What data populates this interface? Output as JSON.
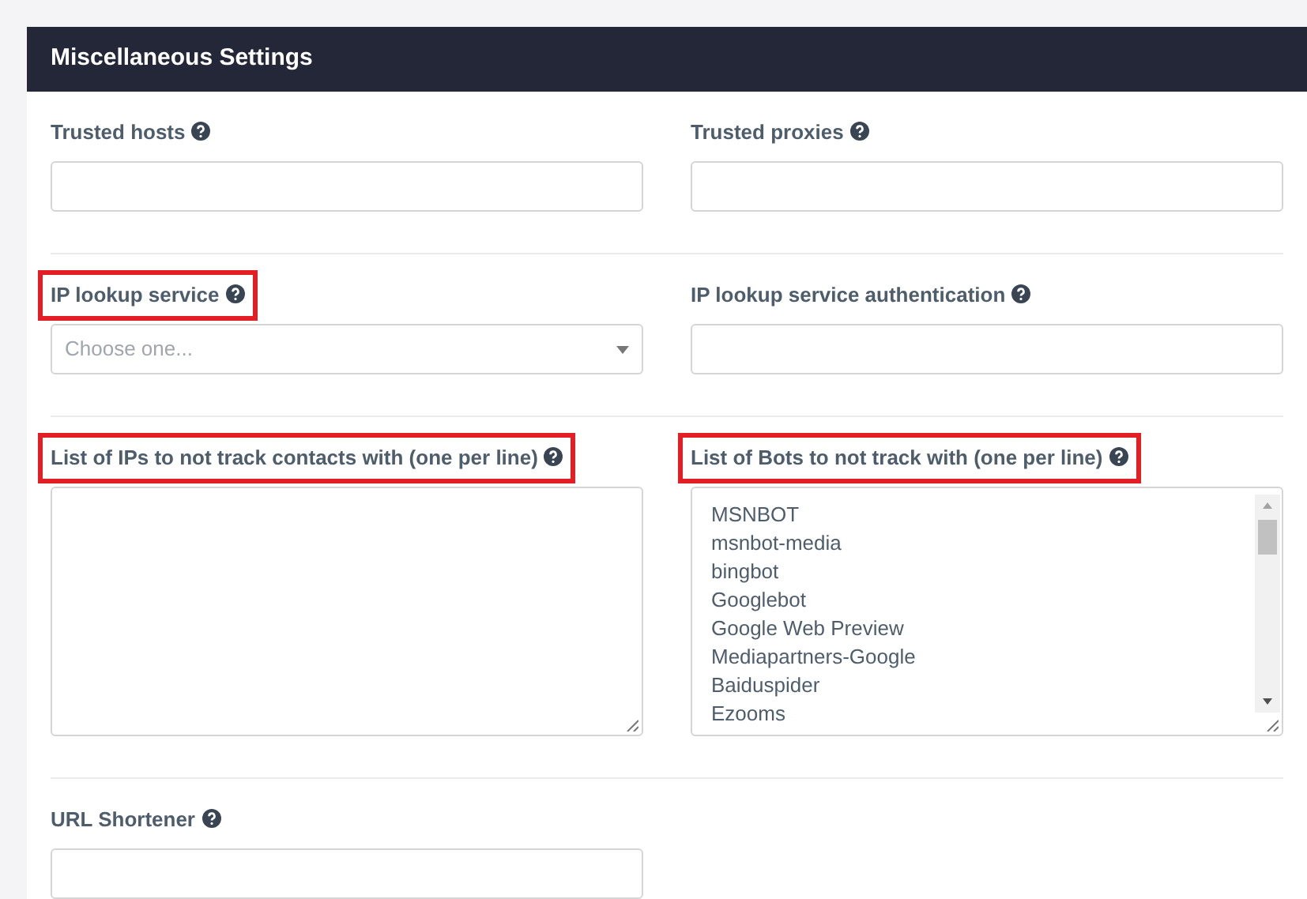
{
  "panel": {
    "title": "Miscellaneous Settings"
  },
  "rows": [
    {
      "fields": [
        {
          "kind": "text",
          "label": "Trusted hosts",
          "highlighted": false
        },
        {
          "kind": "text",
          "label": "Trusted proxies",
          "highlighted": false
        }
      ]
    },
    {
      "fields": [
        {
          "kind": "select",
          "label": "IP lookup service",
          "placeholder": "Choose one...",
          "highlighted": true
        },
        {
          "kind": "text",
          "label": "IP lookup service authentication",
          "highlighted": false
        }
      ]
    },
    {
      "fields": [
        {
          "kind": "textarea",
          "label": "List of IPs to not track contacts with (one per line)",
          "highlighted": true
        },
        {
          "kind": "textarea",
          "label": "List of Bots to not track with (one per line)",
          "highlighted": true,
          "lines": [
            "MSNBOT",
            "msnbot-media",
            "bingbot",
            "Googlebot",
            "Google Web Preview",
            "Mediapartners-Google",
            "Baiduspider",
            "Ezooms"
          ]
        }
      ]
    },
    {
      "fields": [
        {
          "kind": "text",
          "label": "URL Shortener",
          "highlighted": false
        }
      ]
    }
  ]
}
